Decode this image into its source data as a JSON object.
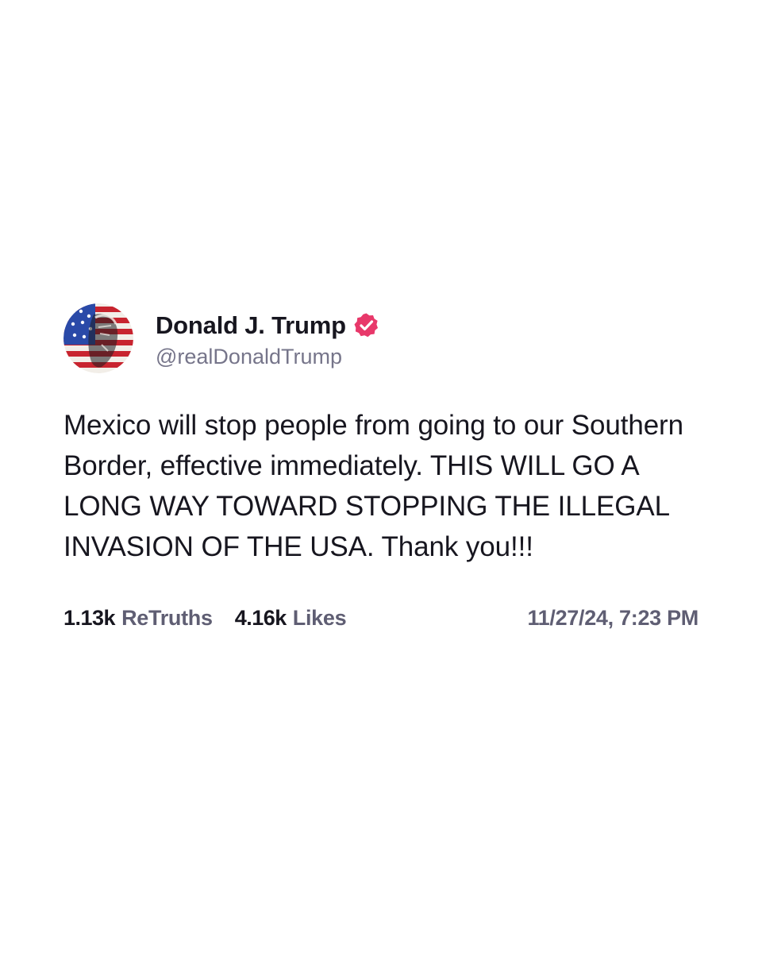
{
  "post": {
    "author": {
      "display_name": "Donald J. Trump",
      "handle": "@realDonaldTrump",
      "verified_badge_icon": "verified-badge-icon",
      "verified_color": "#e8386a"
    },
    "text": "Mexico will stop people from going to our Southern Border, effective immediately. THIS WILL GO A LONG WAY TOWARD STOPPING THE ILLEGAL INVASION OF THE USA. Thank you!!!",
    "stats": {
      "retruths_count": "1.13k",
      "retruths_label": "ReTruths",
      "likes_count": "4.16k",
      "likes_label": "Likes"
    },
    "timestamp": "11/27/24, 7:23 PM"
  }
}
